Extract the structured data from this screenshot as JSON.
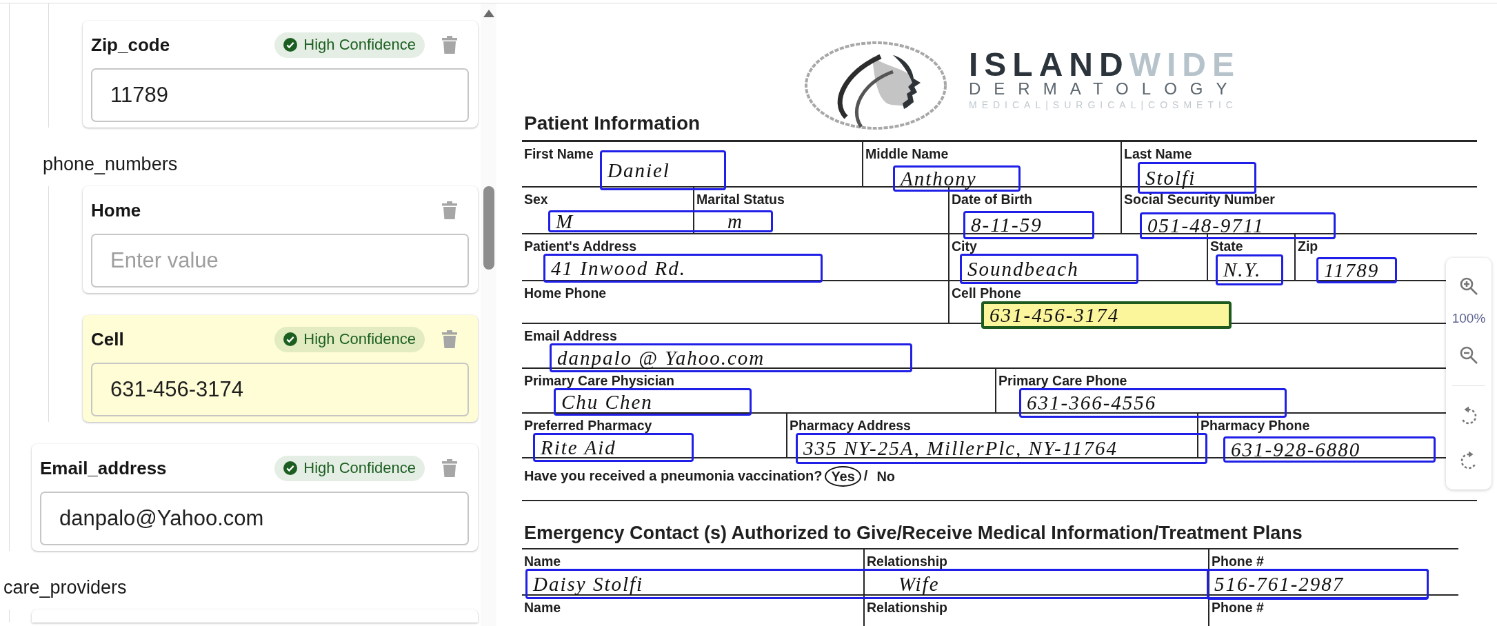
{
  "fields_panel": {
    "items": [
      {
        "kind": "group",
        "children": [
          {
            "kind": "group",
            "children": [
              {
                "kind": "field",
                "label": "Zip_code",
                "badge": "High Confidence",
                "value": "11789",
                "selected": false
              }
            ]
          },
          {
            "kind": "group",
            "title": "phone_numbers",
            "children": [
              {
                "kind": "field",
                "label": "Home",
                "placeholder": "Enter value",
                "selected": false
              },
              {
                "kind": "field",
                "label": "Cell",
                "badge": "High Confidence",
                "value": "631-456-3174",
                "selected": true
              }
            ]
          },
          {
            "kind": "field",
            "label": "Email_address",
            "badge": "High Confidence",
            "value": "danpalo@Yahoo.com",
            "selected": false
          }
        ]
      },
      {
        "kind": "group",
        "title": "care_providers",
        "children": [
          {
            "kind": "field",
            "selected": false
          }
        ]
      }
    ]
  },
  "document": {
    "logo": {
      "wordmark": [
        {
          "text": "ISLAND",
          "color": "#2b343b"
        },
        {
          "text": "WIDE",
          "color": "#b7c3cb"
        }
      ],
      "subtitle": "DERMATOLOGY",
      "tagline": "MEDICAL|SURGICAL|COSMETIC"
    },
    "sections": [
      {
        "title": "Patient Information",
        "rows": [
          {
            "kind": "fields",
            "cells": [
              "First Name",
              "Middle Name",
              "Last Name"
            ]
          },
          {
            "kind": "fields",
            "cells": [
              "Sex",
              "Marital Status",
              "Date of Birth",
              "Social Security Number"
            ]
          },
          {
            "kind": "fields",
            "cells": [
              "Patient's Address",
              "City",
              "State",
              "Zip"
            ]
          },
          {
            "kind": "fields",
            "cells": [
              "Home Phone",
              "Cell Phone"
            ]
          },
          {
            "kind": "fields",
            "cells": [
              "Email Address"
            ]
          },
          {
            "kind": "fields",
            "cells": [
              "Primary Care Physician",
              "Primary Care Phone"
            ]
          },
          {
            "kind": "fields",
            "cells": [
              "Preferred Pharmacy",
              "Pharmacy Address",
              "Pharmacy Phone"
            ]
          },
          {
            "kind": "question",
            "text": "Have you received a pneumonia vaccination?",
            "separator": "/",
            "options": [
              {
                "label": "Yes",
                "selected": true
              },
              {
                "label": "No",
                "selected": false
              }
            ]
          }
        ]
      },
      {
        "title": "Emergency Contact (s) Authorized to Give/Receive Medical Information/Treatment Plans",
        "rows": [
          {
            "kind": "fields",
            "cells": [
              "Name",
              "Relationship",
              "Phone #"
            ]
          },
          {
            "kind": "fields",
            "cells": [
              "Name",
              "Relationship",
              "Phone #"
            ]
          }
        ]
      }
    ],
    "detections": [
      {
        "texts": [
          "Daniel"
        ],
        "selected": false
      },
      {
        "texts": [
          "Anthony"
        ],
        "selected": false
      },
      {
        "texts": [
          "Stolfi"
        ],
        "selected": false
      },
      {
        "texts": [
          "M",
          "m"
        ],
        "selected": false
      },
      {
        "texts": [
          "8-11-59"
        ],
        "selected": false
      },
      {
        "texts": [
          "051-48-9711"
        ],
        "selected": false
      },
      {
        "texts": [
          "41 Inwood Rd."
        ],
        "selected": false
      },
      {
        "texts": [
          "Soundbeach"
        ],
        "selected": false
      },
      {
        "texts": [
          "N.Y."
        ],
        "selected": false
      },
      {
        "texts": [
          "11789"
        ],
        "selected": false
      },
      {
        "texts": [
          "631-456-3174"
        ],
        "selected": true
      },
      {
        "texts": [
          "danpalo @ Yahoo.com"
        ],
        "selected": false
      },
      {
        "texts": [
          "Chu Chen"
        ],
        "selected": false
      },
      {
        "texts": [
          "631-366-4556"
        ],
        "selected": false
      },
      {
        "texts": [
          "Rite Aid"
        ],
        "selected": false
      },
      {
        "texts": [
          "335 NY-25A, MillerPlc, NY-11764"
        ],
        "selected": false
      },
      {
        "texts": [
          "631-928-6880"
        ],
        "selected": false
      },
      {
        "texts": [
          "Daisy Stolfi",
          "Wife"
        ],
        "selected": false
      },
      {
        "texts": [
          "516-761-2987"
        ],
        "selected": false
      }
    ]
  },
  "zoom_controls": {
    "zoom_level": "100%"
  }
}
